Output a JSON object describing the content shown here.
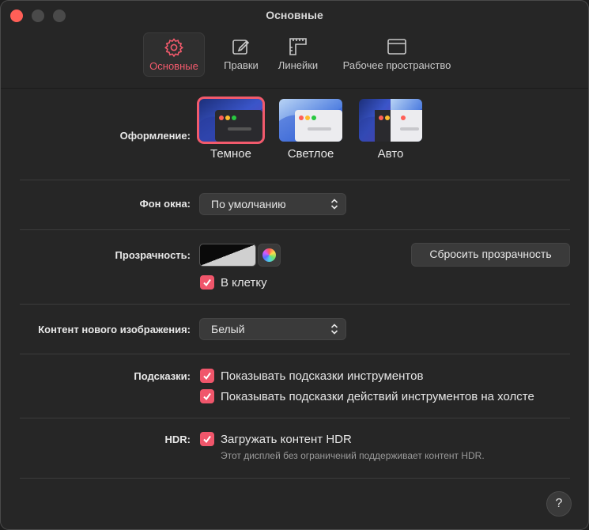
{
  "window": {
    "title": "Основные"
  },
  "tabs": [
    {
      "label": "Основные",
      "icon": "gear-icon",
      "active": true
    },
    {
      "label": "Правки",
      "icon": "edit-icon",
      "active": false
    },
    {
      "label": "Линейки",
      "icon": "ruler-icon",
      "active": false
    },
    {
      "label": "Рабочее пространство",
      "icon": "workspace-icon",
      "active": false
    }
  ],
  "appearance": {
    "label": "Оформление:",
    "options": [
      {
        "label": "Темное",
        "selected": true
      },
      {
        "label": "Светлое",
        "selected": false
      },
      {
        "label": "Авто",
        "selected": false
      }
    ]
  },
  "window_background": {
    "label": "Фон окна:",
    "value": "По умолчанию"
  },
  "transparency": {
    "label": "Прозрачность:",
    "reset_label": "Сбросить прозрачность",
    "checkerboard_label": "В клетку",
    "checkerboard_checked": true
  },
  "new_image_content": {
    "label": "Контент нового изображения:",
    "value": "Белый"
  },
  "tooltips": {
    "label": "Подсказки:",
    "items": [
      {
        "label": "Показывать подсказки инструментов",
        "checked": true
      },
      {
        "label": "Показывать подсказки действий инструментов на холсте",
        "checked": true
      }
    ]
  },
  "hdr": {
    "label": "HDR:",
    "checkbox_label": "Загружать контент HDR",
    "checked": true,
    "note": "Этот дисплей без ограничений поддерживает контент HDR."
  },
  "help": {
    "label": "?"
  },
  "colors": {
    "accent": "#f25a6c",
    "checkbox": "#f0566b",
    "close": "#ff5f57"
  }
}
